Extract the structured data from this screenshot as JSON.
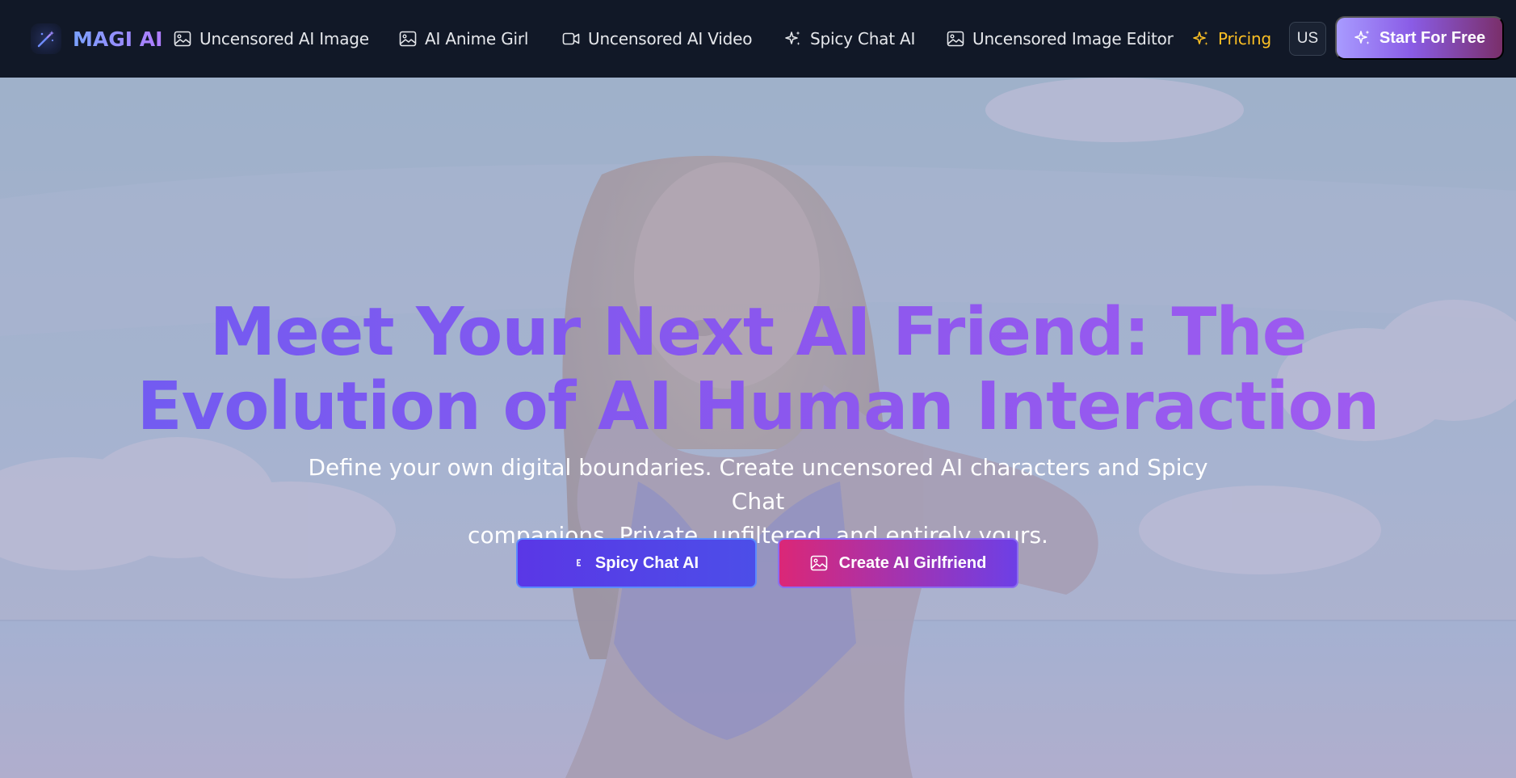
{
  "brand": {
    "name": "MAGI AI",
    "icon": "magic-wand-icon"
  },
  "nav": {
    "links": [
      {
        "label": "Uncensored AI Image",
        "icon": "image-icon"
      },
      {
        "label": "AI Anime Girl",
        "icon": "image-icon"
      },
      {
        "label": "Uncensored AI Video",
        "icon": "video-icon"
      },
      {
        "label": "Spicy Chat AI",
        "icon": "sparkles-icon"
      },
      {
        "label": "Uncensored Image Editor",
        "icon": "image-icon"
      }
    ],
    "pricing": {
      "label": "Pricing",
      "icon": "sparkles-icon",
      "color": "#fbbf24"
    },
    "language": "US",
    "cta": {
      "label": "Start For Free",
      "icon": "sparkles-icon"
    }
  },
  "hero": {
    "title_line1": "Meet Your Next AI Friend: The",
    "title_line2": "Evolution of AI Human Interaction",
    "subtitle_line1": "Define your own digital boundaries. Create uncensored AI characters and Spicy Chat",
    "subtitle_line2": "companions. Private, unfiltered, and entirely yours.",
    "buttons": [
      {
        "label": "Spicy Chat AI",
        "icon": "chat-icon"
      },
      {
        "label": "Create AI Girlfriend",
        "icon": "image-icon"
      }
    ]
  },
  "colors": {
    "nav_bg": "#111827",
    "accent_purple": "#8a57ee",
    "pricing_yellow": "#fbbf24",
    "button_pink": "#db2777"
  }
}
